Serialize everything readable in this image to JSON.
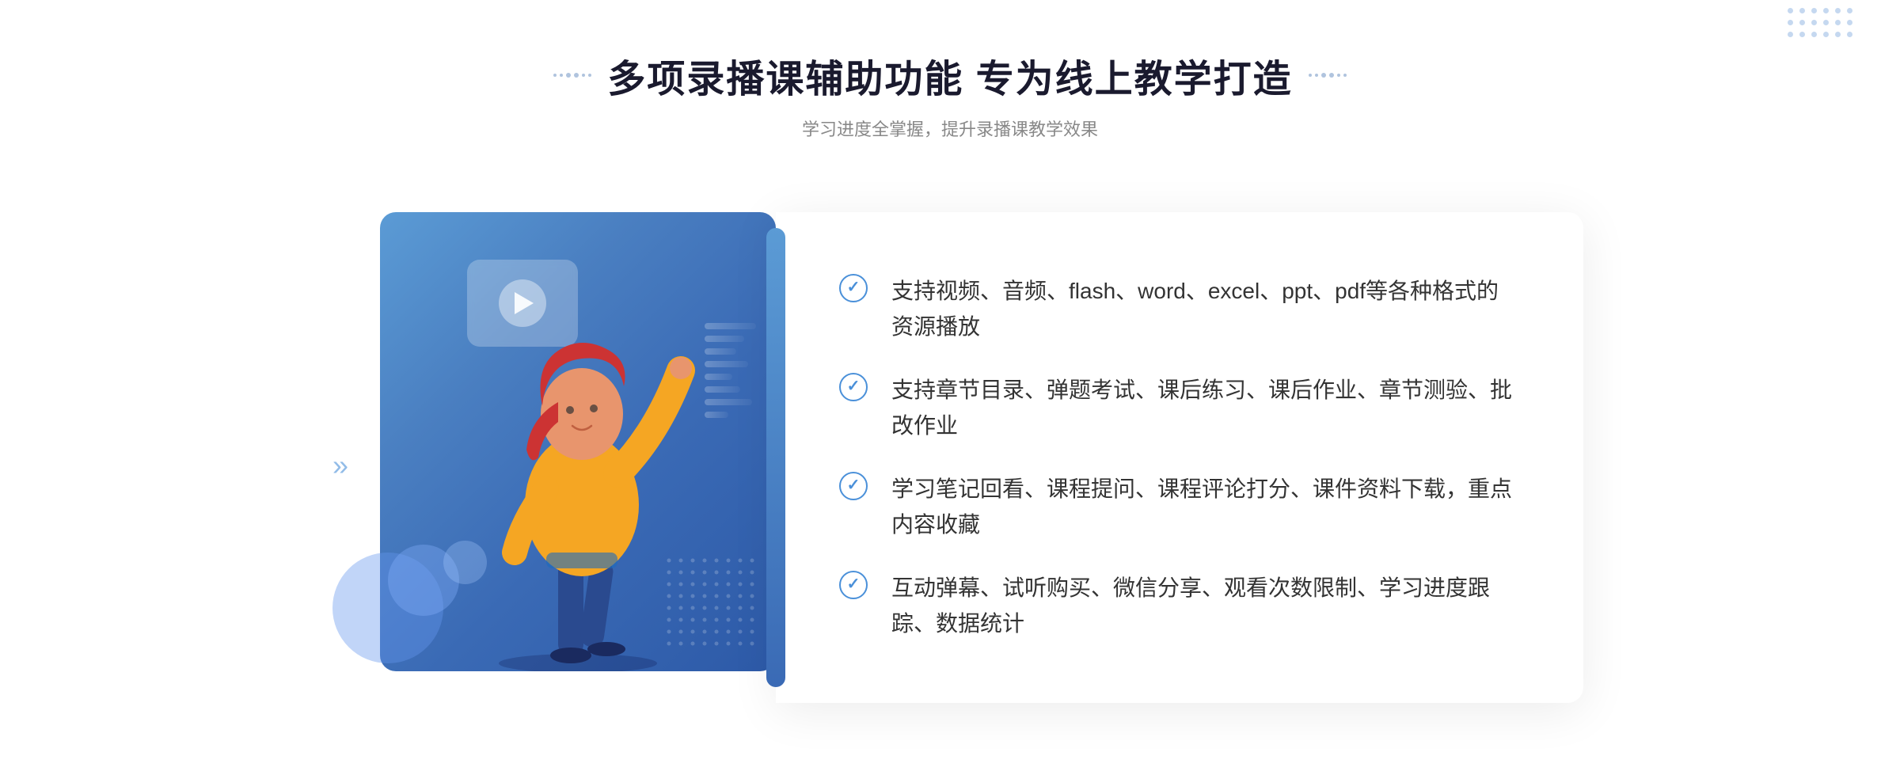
{
  "header": {
    "main_title": "多项录播课辅助功能 专为线上教学打造",
    "sub_title": "学习进度全掌握，提升录播课教学效果"
  },
  "features": [
    {
      "id": 1,
      "text": "支持视频、音频、flash、word、excel、ppt、pdf等各种格式的资源播放"
    },
    {
      "id": 2,
      "text": "支持章节目录、弹题考试、课后练习、课后作业、章节测验、批改作业"
    },
    {
      "id": 3,
      "text": "学习笔记回看、课程提问、课程评论打分、课件资料下载，重点内容收藏"
    },
    {
      "id": 4,
      "text": "互动弹幕、试听购买、微信分享、观看次数限制、学习进度跟踪、数据统计"
    }
  ],
  "decorators": {
    "left_arrow": "»",
    "check_mark": "✓"
  }
}
